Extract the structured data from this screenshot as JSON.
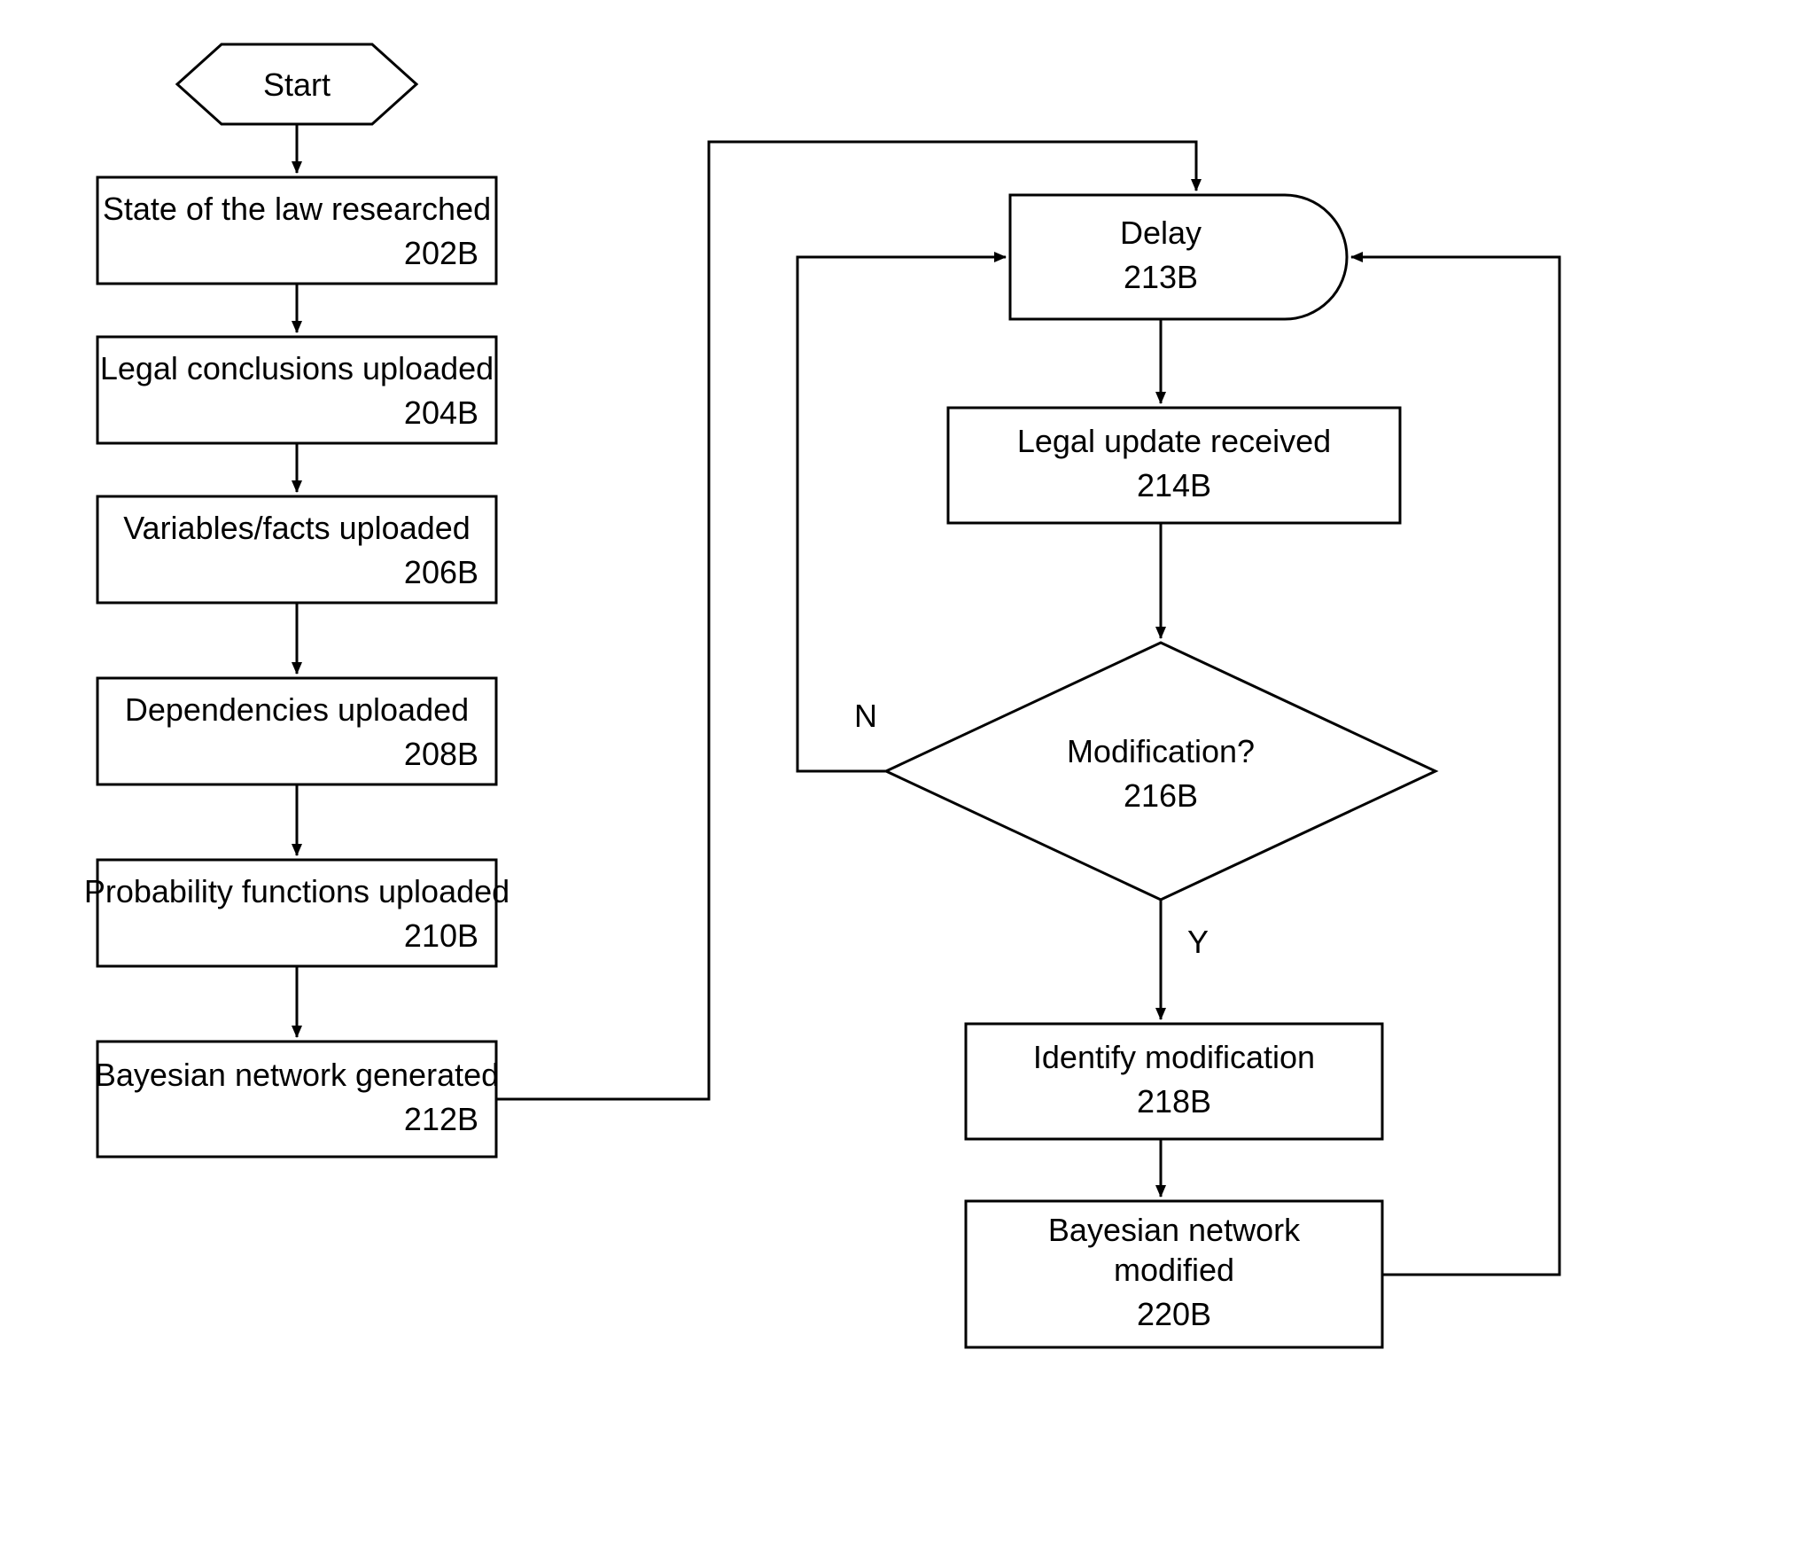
{
  "flowchart": {
    "start": {
      "label": "Start"
    },
    "n202": {
      "text": "State of the law researched",
      "id": "202B"
    },
    "n204": {
      "text": "Legal conclusions uploaded",
      "id": "204B"
    },
    "n206": {
      "text": "Variables/facts uploaded",
      "id": "206B"
    },
    "n208": {
      "text": "Dependencies uploaded",
      "id": "208B"
    },
    "n210": {
      "text": "Probability functions uploaded",
      "id": "210B"
    },
    "n212": {
      "text": "Bayesian network generated",
      "id": "212B"
    },
    "n213": {
      "text": "Delay",
      "id": "213B"
    },
    "n214": {
      "text": "Legal update received",
      "id": "214B"
    },
    "n216": {
      "text": "Modification?",
      "id": "216B"
    },
    "n218": {
      "text": "Identify modification",
      "id": "218B"
    },
    "n220": {
      "text": "Bayesian network modified",
      "id": "220B"
    },
    "edges": {
      "no_label": "N",
      "yes_label": "Y"
    }
  }
}
